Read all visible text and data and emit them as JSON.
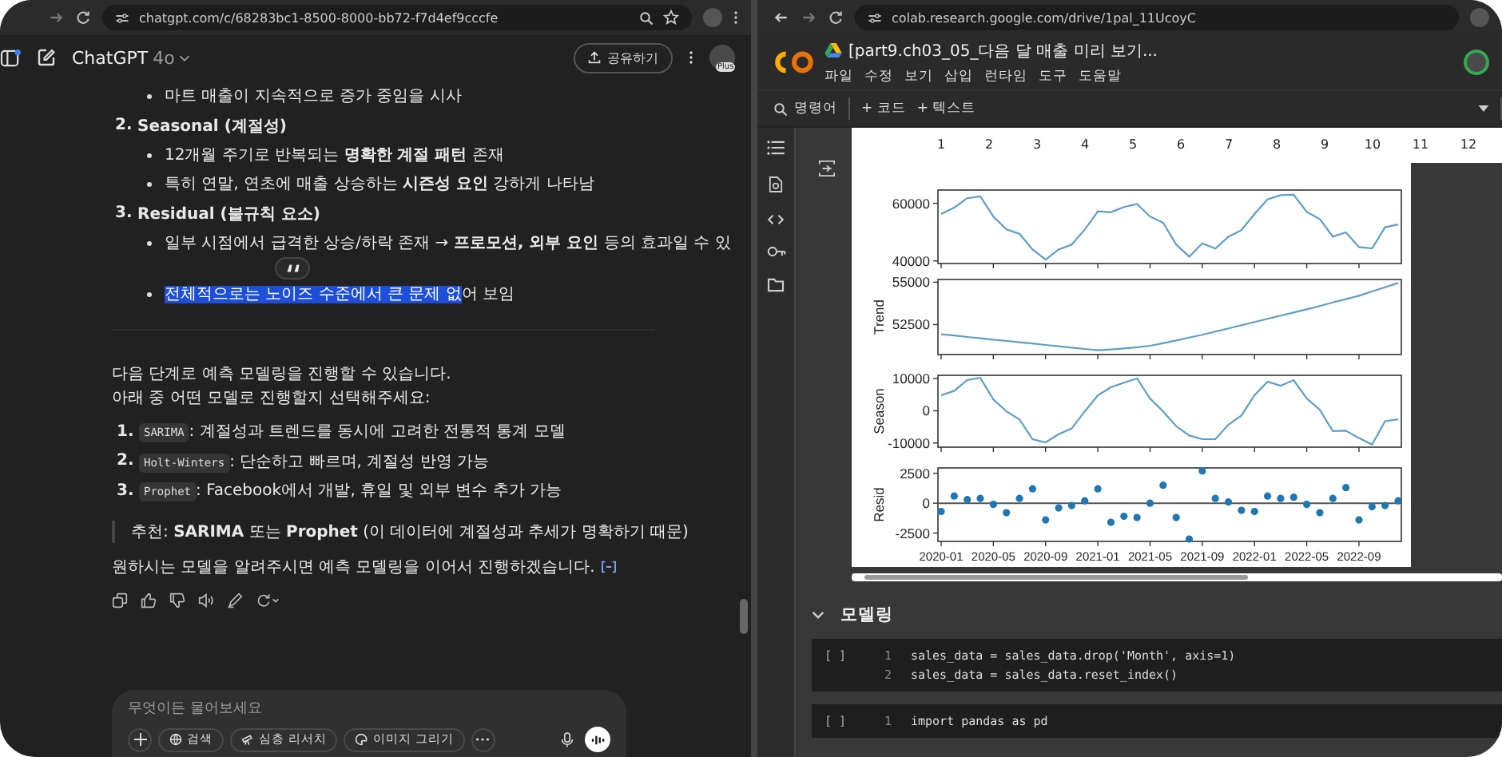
{
  "chatgpt": {
    "url": "chatgpt.com/c/68283bc1-8500-8000-bb72-f7d4ef9cccfe",
    "model": "ChatGPT",
    "version": "4o",
    "share_button": "공유하기",
    "avatar_badge": "Plus",
    "top_bullet": "마트 매출이 지속적으로 증가 중임을 시사",
    "sections": [
      {
        "number": "2.",
        "title": "Seasonal (계절성)",
        "bullets": [
          {
            "text": "12개월 주기로 반복되는 **명확한 계절 패턴** 존재"
          },
          {
            "text": "특히 연말, 연초에 매출 상승하는 **시즌성 요인** 강하게 나타남"
          }
        ]
      },
      {
        "number": "3.",
        "title": "Residual (불규칙 요소)",
        "bullets": [
          {
            "text": "일부 시점에서 급격한 상승/하락 존재 → **프로모션, 외부 요인** 등의 효과일 수 있",
            "quote_popup": true
          },
          {
            "highlight": "전체적으로는 노이즈 수준에서 큰 문제 없",
            "text": "어 보임"
          }
        ]
      }
    ],
    "intro": [
      "다음 단계로 예측 모델링을 진행할 수 있습니다.",
      "아래 중 어떤 모델로 진행할지 선택해주세요:"
    ],
    "models": [
      {
        "number": "1.",
        "code": "SARIMA",
        "text": ": 계절성과 트렌드를 동시에 고려한 전통적 통계 모델"
      },
      {
        "number": "2.",
        "code": "Holt-Winters",
        "text": ": 단순하고 빠르며, 계절성 반영 가능"
      },
      {
        "number": "3.",
        "code": "Prophet",
        "text": ": Facebook에서 개발, 휴일 및 외부 변수 추가 가능"
      }
    ],
    "recommendation": "추천: **SARIMA** 또는 **Prophet** (이 데이터에 계절성과 추세가 명확하기 때문)",
    "closing": "원하시는 모델을 알려주시면 예측 모델링을 이어서 진행하겠습니다.",
    "composer": {
      "placeholder": "무엇이든 물어보세요",
      "tools": [
        {
          "kind": "globe",
          "label": "검색"
        },
        {
          "kind": "research",
          "label": "심층 리서치"
        },
        {
          "kind": "image",
          "label": "이미지 그리기"
        }
      ]
    }
  },
  "colab": {
    "url": "colab.research.google.com/drive/1pal_11UcoyC",
    "notebook_title": "[part9.ch03_05_다음 달 매출 미리 보기...",
    "menu": [
      "파일",
      "수정",
      "보기",
      "삽입",
      "런타임",
      "도구",
      "도움말"
    ],
    "toolbar": {
      "commands": "명령어",
      "add_code": "+ 코드",
      "add_text": "+ 텍스트"
    },
    "previous_output_ticks": [
      "1",
      "2",
      "3",
      "4",
      "5",
      "6",
      "7",
      "8",
      "9",
      "10",
      "11",
      "12"
    ],
    "subplots": [
      {
        "chart_data": {
          "type": "line",
          "ylim": [
            39100,
            64600
          ],
          "yticks": [
            40000,
            60000
          ],
          "categories": [
            null,
            null,
            null,
            null,
            null,
            null,
            null,
            null,
            null,
            null,
            null,
            null,
            null,
            null,
            null,
            null,
            null,
            null,
            null,
            null,
            null,
            null,
            null,
            null,
            null,
            null,
            null,
            null,
            null,
            null,
            null,
            null,
            null,
            null,
            null,
            null
          ],
          "series": [
            {
              "color": "#5b9ec9",
              "values": [
                56300,
                58500,
                61800,
                62400,
                55400,
                50900,
                49400,
                44000,
                40500,
                44000,
                45700,
                50900,
                57200,
                56900,
                58700,
                59800,
                55400,
                53300,
                45700,
                41500,
                46100,
                44300,
                48400,
                50700,
                56300,
                61400,
                62800,
                63000,
                57000,
                54500,
                48400,
                49900,
                44800,
                44300,
                51700,
                52600
              ]
            }
          ]
        }
      },
      {
        "chart_data": {
          "type": "line",
          "ylabel": "Trend",
          "ylim": [
            50730,
            55160
          ],
          "yticks": [
            52500,
            55000
          ],
          "categories": [
            null,
            null,
            null,
            null,
            null,
            null,
            null,
            null,
            null,
            null,
            null,
            null,
            null,
            null,
            null,
            null,
            null,
            null,
            null,
            null,
            null,
            null,
            null,
            null,
            null,
            null,
            null,
            null,
            null,
            null,
            null,
            null,
            null,
            null,
            null,
            null
          ],
          "series": [
            {
              "color": "#5b9ec9",
              "values": [
                51930,
                51850,
                51770,
                51690,
                51610,
                51530,
                51460,
                51380,
                51300,
                51220,
                51140,
                51060,
                50980,
                51030,
                51090,
                51160,
                51250,
                51400,
                51560,
                51730,
                51900,
                52090,
                52280,
                52460,
                52650,
                52840,
                53030,
                53210,
                53400,
                53600,
                53800,
                54000,
                54200,
                54450,
                54700,
                54950
              ]
            }
          ]
        }
      },
      {
        "chart_data": {
          "type": "line",
          "ylabel": "Season",
          "ylim": [
            -11300,
            11000
          ],
          "yticks": [
            -10000,
            0,
            10000
          ],
          "categories": [
            null,
            null,
            null,
            null,
            null,
            null,
            null,
            null,
            null,
            null,
            null,
            null,
            null,
            null,
            null,
            null,
            null,
            null,
            null,
            null,
            null,
            null,
            null,
            null,
            null,
            null,
            null,
            null,
            null,
            null,
            null,
            null,
            null,
            null,
            null,
            null
          ],
          "series": [
            {
              "color": "#5b9ec9",
              "values": [
                4800,
                6200,
                9500,
                10200,
                3500,
                -200,
                -2700,
                -8800,
                -9800,
                -7300,
                -5500,
                -200,
                4800,
                7300,
                8700,
                10000,
                3800,
                -200,
                -4800,
                -7700,
                -8800,
                -8800,
                -4300,
                -1500,
                4800,
                9000,
                7800,
                9500,
                3800,
                300,
                -6300,
                -6200,
                -8500,
                -10500,
                -3200,
                -2700
              ]
            }
          ]
        }
      },
      {
        "chart_data": {
          "type": "scatter",
          "ylabel": "Resid",
          "ylim": [
            -3200,
            2950
          ],
          "yticks": [
            -2500,
            0,
            2500
          ],
          "categories": [
            "2020-01",
            null,
            null,
            null,
            "2020-05",
            null,
            null,
            null,
            "2020-09",
            null,
            null,
            null,
            "2021-01",
            null,
            null,
            null,
            "2021-05",
            null,
            null,
            null,
            "2021-09",
            null,
            null,
            null,
            "2022-01",
            null,
            null,
            null,
            "2022-05",
            null,
            null,
            null,
            "2022-09",
            null,
            null,
            null
          ],
          "values": [
            -700,
            600,
            300,
            400,
            -100,
            -800,
            400,
            1200,
            -1400,
            -400,
            -200,
            200,
            1200,
            -1600,
            -1100,
            -1200,
            0,
            1500,
            -1200,
            -3000,
            2700,
            400,
            100,
            -600,
            -700,
            600,
            400,
            500,
            -100,
            -800,
            400,
            1300,
            -1400,
            -300,
            -200,
            200
          ]
        }
      }
    ],
    "section": {
      "title": "모델링",
      "expanded": true
    },
    "cells": [
      {
        "run_label": "[ ]",
        "lines": [
          {
            "number": "1",
            "code": "sales_data = sales_data.drop('Month', axis=1)"
          },
          {
            "number": "2",
            "code": "sales_data = sales_data.reset_index()"
          }
        ]
      },
      {
        "run_label": "[ ]",
        "lines": [
          {
            "number": "1",
            "code": "import pandas as pd"
          }
        ]
      }
    ]
  }
}
